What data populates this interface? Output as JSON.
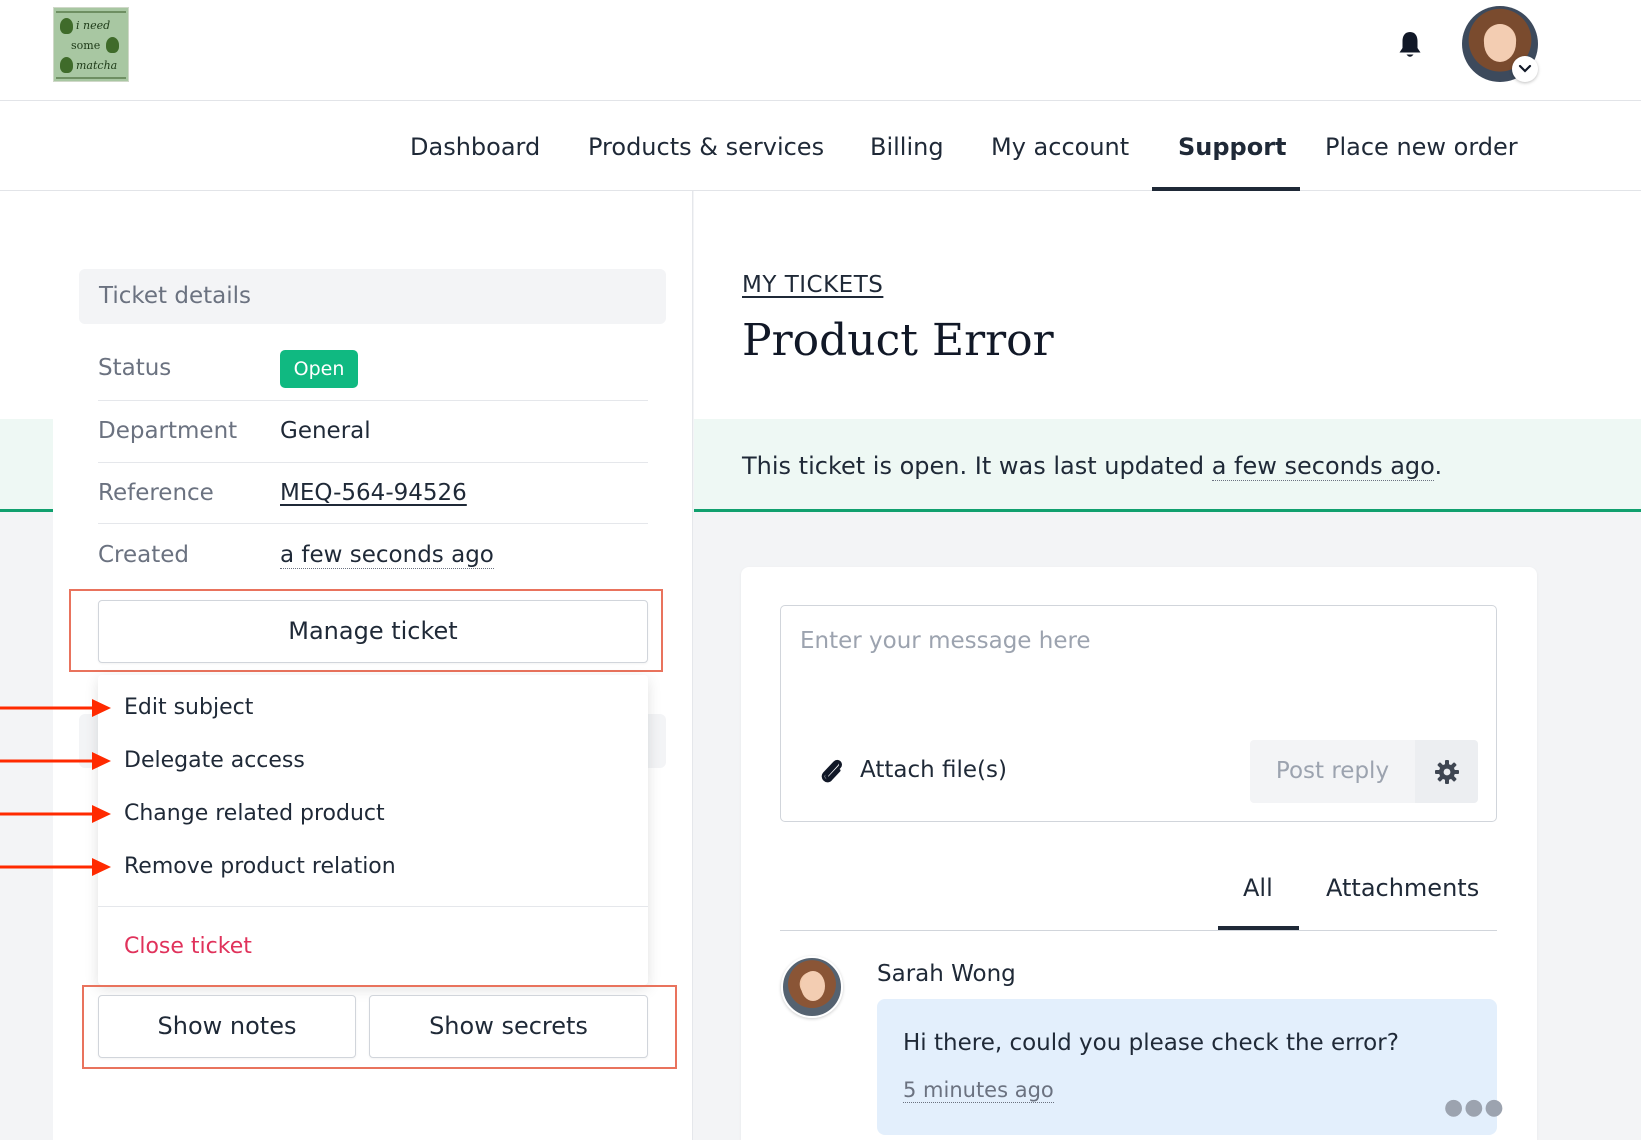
{
  "header": {
    "logo_text": [
      "i need",
      "some",
      "matcha"
    ],
    "icons": {
      "notifications": "bell-icon",
      "account_menu": "chevron-down-icon"
    }
  },
  "nav": {
    "items": [
      "Dashboard",
      "Products & services",
      "Billing",
      "My account",
      "Support",
      "Place new order"
    ],
    "active": "Support"
  },
  "ticket_details": {
    "heading": "Ticket details",
    "status_label": "Status",
    "status_value": "Open",
    "department_label": "Department",
    "department_value": "General",
    "reference_label": "Reference",
    "reference_value": "MEQ-564-94526",
    "created_label": "Created",
    "created_value": "a few seconds ago"
  },
  "manage": {
    "button_label": "Manage ticket",
    "menu_items": [
      "Edit subject",
      "Delegate access",
      "Change related product",
      "Remove product relation"
    ],
    "close_label": "Close ticket"
  },
  "toggles": {
    "notes_label": "Show notes",
    "secrets_label": "Show secrets"
  },
  "main": {
    "breadcrumb": "MY TICKETS",
    "title": "Product Error",
    "banner_prefix": "This ticket is open. It was last updated ",
    "banner_time": "a few seconds ago",
    "banner_suffix": "."
  },
  "composer": {
    "placeholder": "Enter your message here",
    "attach_label": "Attach file(s)",
    "post_label": "Post reply",
    "icons": {
      "attach": "paperclip-icon",
      "settings": "gear-icon"
    }
  },
  "thread_tabs": {
    "all": "All",
    "attachments": "Attachments",
    "active": "All"
  },
  "messages": [
    {
      "author": "Sarah Wong",
      "text": "Hi there, could you please check the error?",
      "time": "5 minutes ago"
    }
  ],
  "colors": {
    "status_open": "#10b981",
    "danger": "#e0325b",
    "banner_bg": "#eef8f4",
    "banner_accent": "#10a06e",
    "bubble_bg": "#e3effc",
    "annotation_red": "#ff2a00"
  }
}
